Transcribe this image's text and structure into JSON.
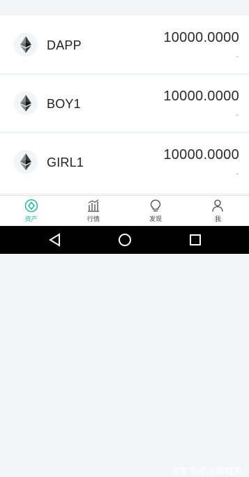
{
  "assets": [
    {
      "name": "DAPP",
      "amount": "10000.0000",
      "sub": "-",
      "icon": "ethereum-icon"
    },
    {
      "name": "BOY1",
      "amount": "10000.0000",
      "sub": "-",
      "icon": "ethereum-icon"
    },
    {
      "name": "GIRL1",
      "amount": "10000.0000",
      "sub": "-",
      "icon": "ethereum-icon"
    }
  ],
  "nav": {
    "items": [
      {
        "label": "资产",
        "icon": "assets-icon",
        "active": true
      },
      {
        "label": "行情",
        "icon": "market-chart-icon",
        "active": false
      },
      {
        "label": "发现",
        "icon": "lightbulb-icon",
        "active": false
      },
      {
        "label": "我",
        "icon": "person-icon",
        "active": false
      }
    ]
  },
  "system_nav": {
    "back": "back-triangle-icon",
    "home": "home-circle-icon",
    "recents": "recents-square-icon"
  },
  "watermark": "百家号/职业刷糖果",
  "colors": {
    "accent": "#23b6a0",
    "eth_dark": "#3c3c3b",
    "eth_light": "#8c8c8c"
  }
}
